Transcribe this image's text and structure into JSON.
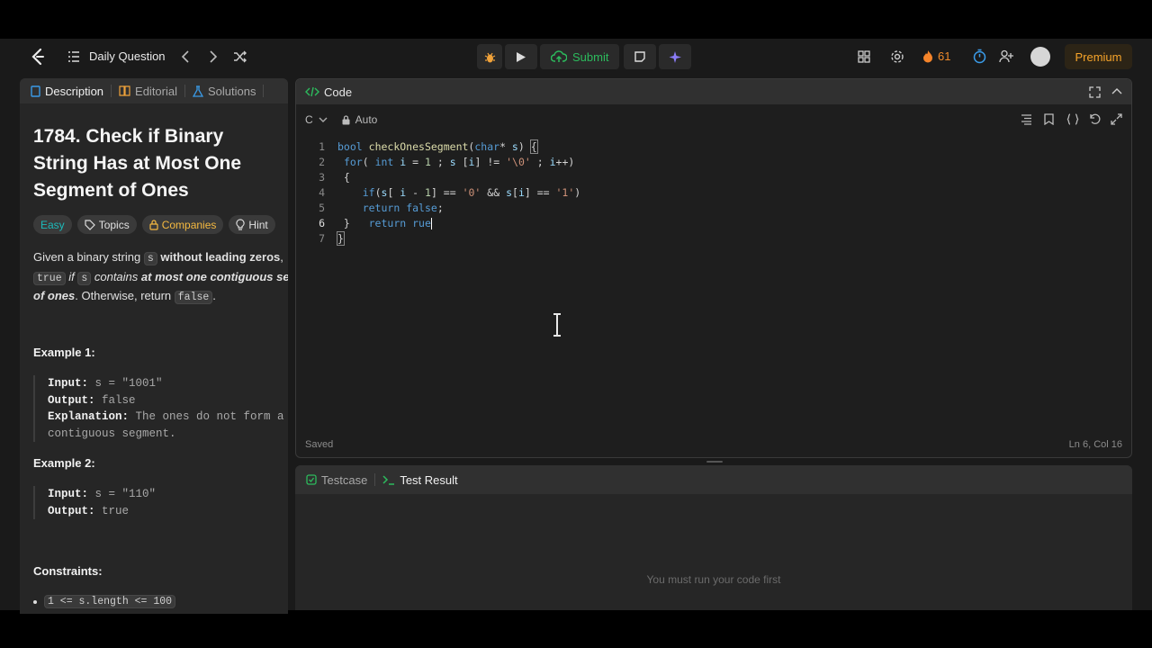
{
  "topbar": {
    "nav_title": "Daily Question",
    "submit_label": "Submit",
    "streak_count": "61",
    "premium_label": "Premium"
  },
  "left_panel": {
    "tabs": [
      {
        "label": "Description"
      },
      {
        "label": "Editorial"
      },
      {
        "label": "Solutions"
      }
    ],
    "problem_title": "1784. Check if Binary String Has at Most One Segment of Ones",
    "tags": {
      "difficulty": "Easy",
      "topics": "Topics",
      "companies": "Companies",
      "hint": "Hint"
    },
    "description": {
      "p1_a": "Given a binary string ",
      "p1_code1": "s",
      "p1_b": " without leading zeros",
      "p1_c": ",",
      "p2_code": "true",
      "p2_a": " if ",
      "p2_code2": "s",
      "p2_b": " contains ",
      "p2_c": "at most one contiguous se",
      "p3_a": "of ones",
      "p3_b": ". Otherwise, return ",
      "p3_code": "false",
      "p3_c": "."
    },
    "example1": {
      "heading": "Example 1:",
      "input_label": "Input:",
      "input_value": " s = \"1001\"",
      "output_label": "Output:",
      "output_value": " false",
      "explanation_label": "Explanation:",
      "explanation_value": " The ones do not form a",
      "explanation_value2": "contiguous segment."
    },
    "example2": {
      "heading": "Example 2:",
      "input_label": "Input:",
      "input_value": " s = \"110\"",
      "output_label": "Output:",
      "output_value": " true"
    },
    "constraints_heading": "Constraints:",
    "constraint_1": "1 <= s.length <= 100"
  },
  "code_panel": {
    "title": "Code",
    "language": "C",
    "mode": "Auto",
    "line_numbers": [
      "1",
      "2",
      "3",
      "4",
      "5",
      "6",
      "7"
    ],
    "status": "Saved",
    "cursor_position": "Ln 6, Col 16"
  },
  "test_panel": {
    "testcase_tab": "Testcase",
    "result_tab": "Test Result",
    "message": "You must run your code first"
  },
  "colors": {
    "accent_green": "#2cbb5d",
    "premium_orange": "#f7a42a",
    "easy_teal": "#1cbaba",
    "code_keyword": "#569cd6"
  },
  "icons": [
    "logo-icon",
    "list-icon",
    "chevron-left-icon",
    "chevron-right-icon",
    "shuffle-icon",
    "debug-icon",
    "play-icon",
    "cloud-upload-icon",
    "note-icon",
    "sparkle-icon",
    "grid-icon",
    "gear-icon",
    "flame-icon",
    "timer-icon",
    "add-user-icon",
    "code-icon",
    "lock-icon",
    "expand-icon",
    "collapse-icon",
    "format-icon",
    "bookmark-icon",
    "braces-icon",
    "reset-icon",
    "fullscreen-icon",
    "checkbox-icon",
    "terminal-icon"
  ]
}
